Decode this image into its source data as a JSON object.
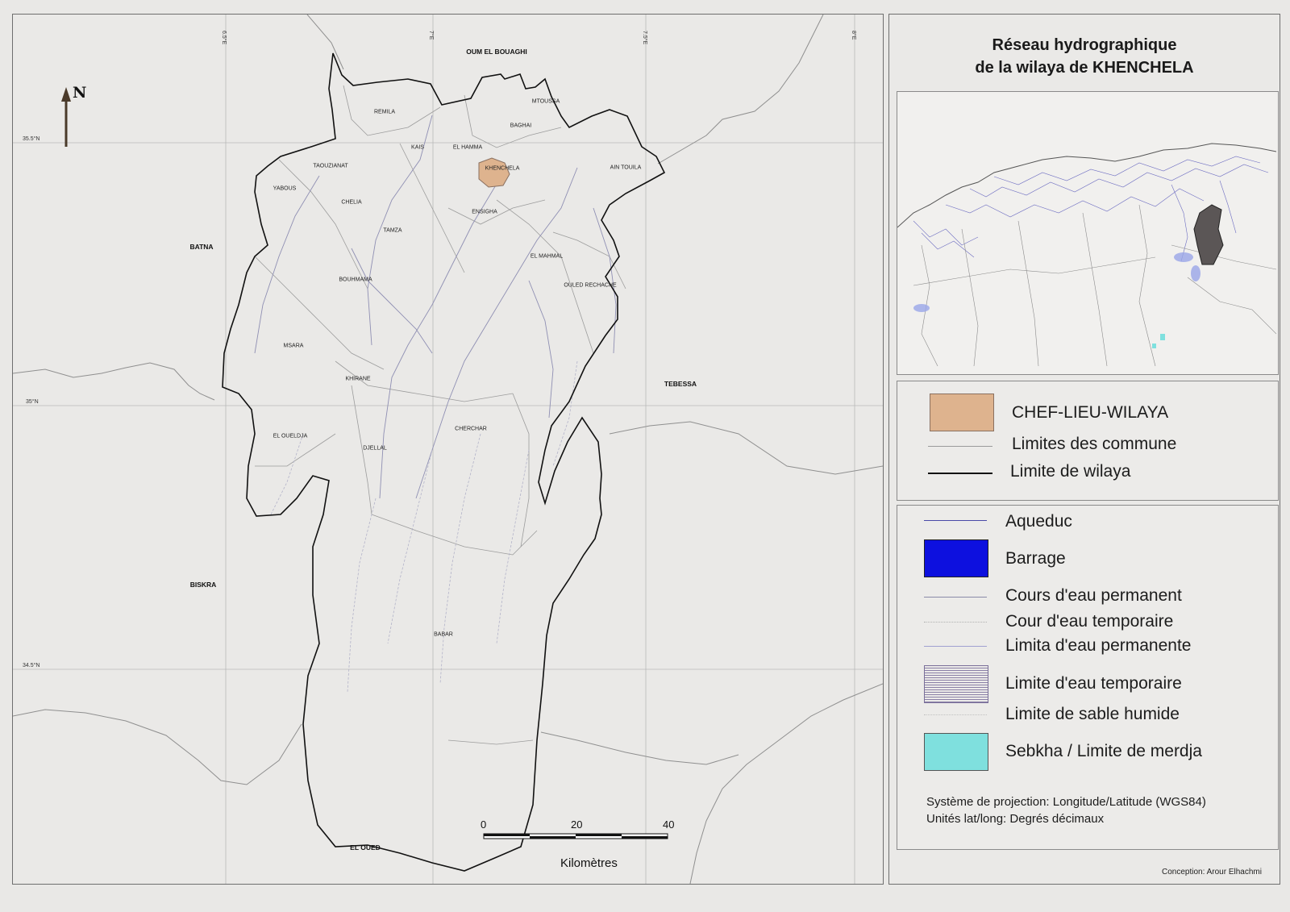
{
  "title_line1": "Réseau hydrographique",
  "title_line2": "de la wilaya de KHENCHELA",
  "communes": [
    {
      "name": "REMILA"
    },
    {
      "name": "MTOUSSA"
    },
    {
      "name": "BAGHAI"
    },
    {
      "name": "KAIS"
    },
    {
      "name": "EL HAMMA"
    },
    {
      "name": "KHENCHELA"
    },
    {
      "name": "TAOUZIANAT"
    },
    {
      "name": "AIN TOUILA"
    },
    {
      "name": "YABOUS"
    },
    {
      "name": "CHELIA"
    },
    {
      "name": "ENSIGHA"
    },
    {
      "name": "TAMZA"
    },
    {
      "name": "EL MAHMAL"
    },
    {
      "name": "BOUHMAMA"
    },
    {
      "name": "OULED RECHACHE"
    },
    {
      "name": "MSARA"
    },
    {
      "name": "KHIRANE"
    },
    {
      "name": "CHERCHAR"
    },
    {
      "name": "EL OUELDJA"
    },
    {
      "name": "DJELLAL"
    },
    {
      "name": "BABAR"
    }
  ],
  "neighbors": [
    "OUM EL BOUAGHI",
    "BATNA",
    "TEBESSA",
    "BISKRA",
    "EL OUED"
  ],
  "grid_labels": {
    "lon": [
      "6.5°E",
      "7°E",
      "7.5°E",
      "8°E"
    ],
    "lat": [
      "35.5°N",
      "35°N",
      "34.5°N"
    ]
  },
  "north_label": "N",
  "scale": {
    "ticks": [
      "0",
      "20",
      "40"
    ],
    "unit": "Kilomètres"
  },
  "legend_boundaries": [
    {
      "label": "CHEF-LIEU-WILAYA",
      "symbol": "fill",
      "color": "#deb38e"
    },
    {
      "label": "Limites des commune",
      "symbol": "line",
      "color": "#9a9a9a"
    },
    {
      "label": "Limite de wilaya",
      "symbol": "line",
      "color": "#111111"
    }
  ],
  "legend_hydro": [
    {
      "label": "Aqueduc",
      "symbol": "line",
      "color": "#4a4aa8"
    },
    {
      "label": "Barrage",
      "symbol": "fill",
      "color": "#0d10df"
    },
    {
      "label": "Cours d'eau permanent",
      "symbol": "line",
      "color": "#8a8aa8"
    },
    {
      "label": "Cour d'eau temporaire",
      "symbol": "dotted",
      "color": "#b0b0b0"
    },
    {
      "label": "Limita d'eau permanente",
      "symbol": "line",
      "color": "#a0a0d0"
    },
    {
      "label": "Limite d'eau temporaire",
      "symbol": "hatch",
      "color": "#8a7fa6"
    },
    {
      "label": "Limite de sable humide",
      "symbol": "dotted",
      "color": "#c0c0c0"
    },
    {
      "label": "Sebkha / Limite de merdja",
      "symbol": "fill",
      "color": "#7fe0de"
    }
  ],
  "projection": "Système de projection: Longitude/Latitude (WGS84)",
  "units": "Unités lat/long: Degrés décimaux",
  "credit": "Conception: Arour Elhachmi",
  "colors": {
    "chef_lieu": "#deb38e",
    "inset_highlight": "#5b5656",
    "barrage": "#0d10df",
    "sebkha": "#7fe0de"
  }
}
